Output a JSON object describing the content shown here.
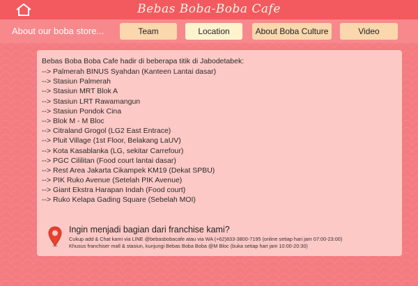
{
  "header": {
    "title": "Bebas Boba-Boba Cafe",
    "home_icon": "home-icon"
  },
  "nav": {
    "heading": "About our boba store...",
    "buttons": [
      {
        "label": "Team",
        "active": false
      },
      {
        "label": "Location",
        "active": true
      },
      {
        "label": "About Boba Culture",
        "active": false
      },
      {
        "label": "Video",
        "active": false
      }
    ]
  },
  "content": {
    "intro": "Bebas Boba Boba Cafe hadir di beberapa titik di Jabodetabek:",
    "locations": [
      "--> Palmerah BINUS Syahdan (Kanteen Lantai dasar)",
      "--> Stasiun Palmerah",
      "--> Stasiun MRT Blok A",
      "--> Stasiun LRT Rawamangun",
      "--> Stasiun Pondok Cina",
      "--> Blok M - M Bloc",
      "--> Citraland Grogol (LG2 East Entrace)",
      "--> Pluit Village (1st Floor, Belakang LaUV)",
      "--> Kota Kasablanka (LG, sekitar Carrefour)",
      "--> PGC Cililitan (Food court lantai dasar)",
      "--> Rest Area Jakarta Cikampek KM19 (Dekat SPBU)",
      "--> PIK Ruko Avenue (Setelah PIK Avenue)",
      "--> Giant Ekstra Harapan Indah (Food court)",
      "--> Ruko Kelapa Gading Square (Sebelah MOI)"
    ]
  },
  "franchise": {
    "icon": "location-pin-icon",
    "title": "Ingin menjadi bagian dari franchise kami?",
    "line1": "Cukup add & Chat kami via LINE @bebasbobacafe atau via WA (+62)833-3800-7195 (online setiap hari jam 07:00-23:00)",
    "line2": "Khusus franchiser mall & stasiun, kunjungi Bebas Boba Boba @M Bloc (buka setiap hari jam 10:00-20:30)"
  },
  "colors": {
    "topbar": "#f25a60",
    "navbar": "#f7898d",
    "background": "#f47b80",
    "button": "#fbd7ad",
    "button_active": "#fdf4cf",
    "panel": "#fcc9c6",
    "pin": "#e8412e"
  }
}
